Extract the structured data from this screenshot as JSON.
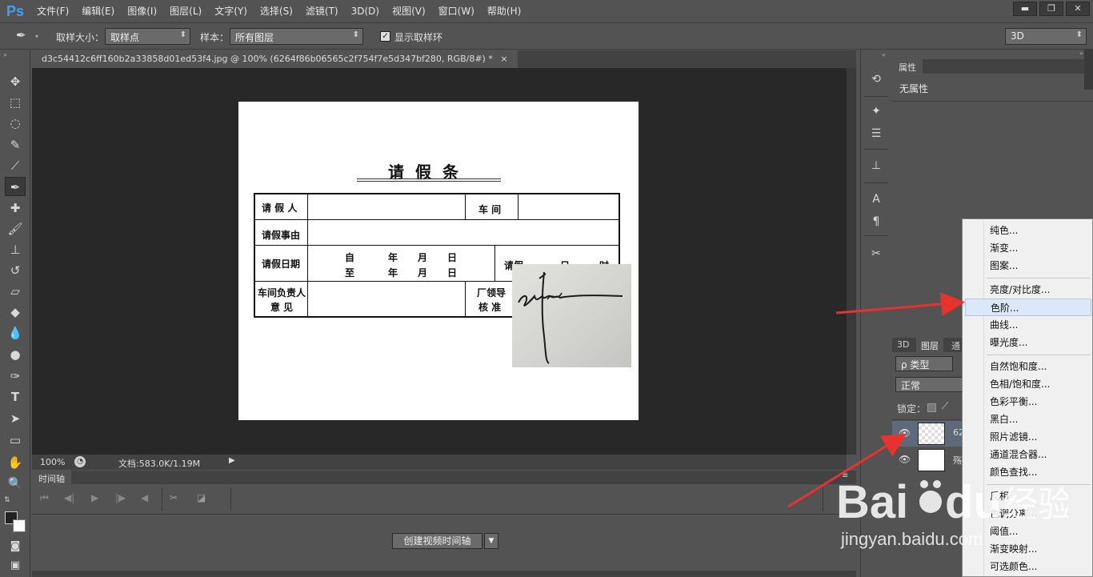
{
  "app": {
    "logo": "Ps"
  },
  "menu": [
    "文件(F)",
    "编辑(E)",
    "图像(I)",
    "图层(L)",
    "文字(Y)",
    "选择(S)",
    "滤镜(T)",
    "3D(D)",
    "视图(V)",
    "窗口(W)",
    "帮助(H)"
  ],
  "window_controls": {
    "minimize": "▬",
    "restore": "❐",
    "close": "✕"
  },
  "options": {
    "sample_size_label": "取样大小：",
    "sample_size_value": "取样点",
    "sample_label": "样本：",
    "sample_value": "所有图层",
    "show_ring_checked": "✓",
    "show_ring_label": "显示取样环",
    "workspace_value": "3D"
  },
  "document": {
    "tab_label": "d3c54412c6ff160b2a33858d01ed53f4.jpg @ 100% (6264f86b06565c2f754f7e5d347bf280, RGB/8#) *",
    "tab_close": "×",
    "zoom": "100%",
    "doc_size": "文档:583.0K/1.19M"
  },
  "paper": {
    "title": "请假条",
    "cells": {
      "leave_person": "请 假 人",
      "workshop": "车 间",
      "leave_reason": "请假事由",
      "leave_date": "请假日期",
      "from": "自",
      "to": "至",
      "year": "年",
      "month": "月",
      "day": "日",
      "leave_partial": "请假",
      "day_partial": "日",
      "hour_partial": "时",
      "workshop_head": "车间负责人",
      "opinion": "意 见",
      "factory_leader": "厂领导",
      "approve": "核 准"
    }
  },
  "timeline": {
    "tab_label": "时间轴",
    "create_button": "创建视频时间轴",
    "dropdown_arrow": "▼"
  },
  "panels": {
    "properties_tab": "属性",
    "no_properties": "无属性",
    "layer_tabs": [
      "3D",
      "图层",
      "通"
    ],
    "layer_filter": "ρ 类型",
    "blend_mode": "正常",
    "lock_label": "锁定：",
    "layers": [
      {
        "eye": "👁",
        "name": "62"
      },
      {
        "eye": "👁",
        "name": "殇"
      }
    ]
  },
  "adjust_menu": {
    "groups": [
      [
        "纯色...",
        "渐变...",
        "图案..."
      ],
      [
        "亮度/对比度...",
        "色阶...",
        "曲线...",
        "曝光度..."
      ],
      [
        "自然饱和度...",
        "色相/饱和度...",
        "色彩平衡...",
        "黑白...",
        "照片滤镜...",
        "通道混合器...",
        "颜色查找..."
      ],
      [
        "反相",
        "色调分离...",
        "阈值...",
        "渐变映射...",
        "可选颜色..."
      ]
    ],
    "highlighted": "色阶..."
  },
  "watermark": {
    "url_text": "jingyan.baidu.com"
  },
  "colors": {
    "arrow": "#e8322e",
    "highlight": "#dce8f8",
    "panel_bg": "#535353",
    "canvas_bg": "#282828"
  }
}
